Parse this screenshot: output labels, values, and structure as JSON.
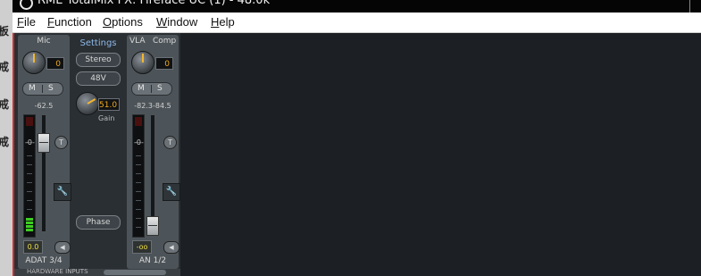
{
  "window": {
    "title": "RME TotalMix FX: Fireface UC (1) - 48.0k"
  },
  "background_chars": [
    "板",
    "戒",
    "戒",
    "戒"
  ],
  "menu": [
    {
      "label": "File",
      "key": "F",
      "rest": "ile"
    },
    {
      "label": "Function",
      "key": "F",
      "rest": "unction"
    },
    {
      "label": "Options",
      "key": "O",
      "rest": "ptions"
    },
    {
      "label": "Window",
      "key": "W",
      "rest": "indow"
    },
    {
      "label": "Help",
      "key": "H",
      "rest": "elp"
    }
  ],
  "mic_channel": {
    "name": "Mic",
    "gain_value": "0",
    "mute": "M",
    "solo": "S",
    "level_db": "-62.5",
    "zero_mark": "-0-",
    "trim": "T",
    "output_value": "0.0",
    "footer": "ADAT 3/4"
  },
  "settings": {
    "title": "Settings",
    "stereo_label": "Stereo",
    "phantom_label": "48V",
    "gain_value": "51.0",
    "gain_label": "Gain",
    "phase_label": "Phase"
  },
  "vla_channel": {
    "name": "VLA",
    "comp_label": "Comp",
    "gain_value": "0",
    "mute": "M",
    "solo": "S",
    "level_db": "-82.3-84.5",
    "zero_mark": "-0-",
    "trim": "T",
    "output_value": "-oo",
    "footer": "AN 1/2"
  },
  "bottom_label": "HARDWARE INPUTS",
  "colors": {
    "accent_value": "#f0a820",
    "meter_green": "#3ccf20",
    "settings_title": "#8fb8e8"
  }
}
